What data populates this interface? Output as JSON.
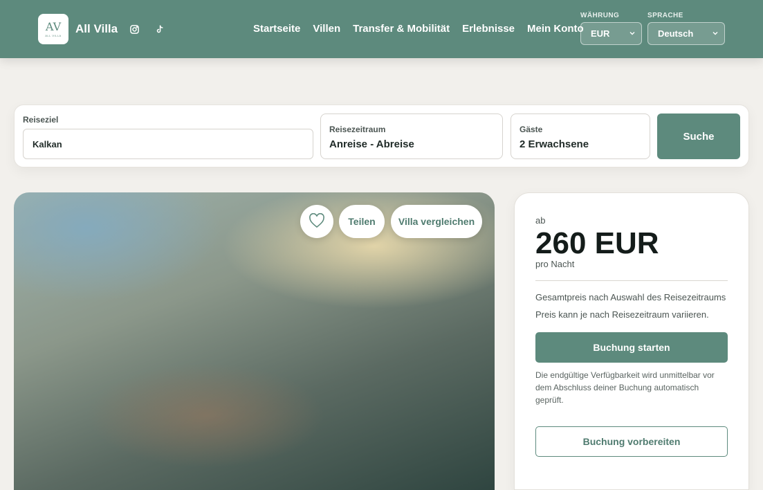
{
  "header": {
    "logo_mark": "AV",
    "logo_subtext": "ALL VILLA",
    "brand": "All Villa",
    "social": [
      {
        "icon": "instagram-icon"
      },
      {
        "icon": "tiktok-icon"
      }
    ],
    "nav": [
      {
        "label": "Startseite"
      },
      {
        "label": "Villen"
      },
      {
        "label": "Transfer & Mobilität"
      },
      {
        "label": "Erlebnisse"
      },
      {
        "label": "Mein Konto"
      }
    ],
    "currency": {
      "label": "WÄHRUNG",
      "value": "EUR"
    },
    "language": {
      "label": "SPRACHE",
      "value": "Deutsch"
    }
  },
  "search": {
    "destination_label": "Reiseziel",
    "destination_value": "Kalkan",
    "period_label": "Reisezeitraum",
    "period_value": "Anreise - Abreise",
    "guests_label": "Gäste",
    "guests_value": "2 Erwachsene",
    "button": "Suche"
  },
  "hero": {
    "favorite_icon": "heart-icon",
    "share": "Teilen",
    "compare": "Villa vergleichen"
  },
  "pricing": {
    "from": "ab",
    "price": "260 EUR",
    "per": "pro Nacht",
    "note1": "Gesamtpreis nach Auswahl des Reisezeitraums",
    "note2": "Preis kann je nach Reisezeitraum variieren.",
    "book_button": "Buchung starten",
    "availability_note": "Die endgültige Verfügbarkeit wird unmittelbar vor dem Abschluss deiner Buchung automatisch geprüft.",
    "prepare_button": "Buchung vorbereiten"
  },
  "colors": {
    "brand_green": "#5d8a7d",
    "background": "#f2f0ec"
  }
}
